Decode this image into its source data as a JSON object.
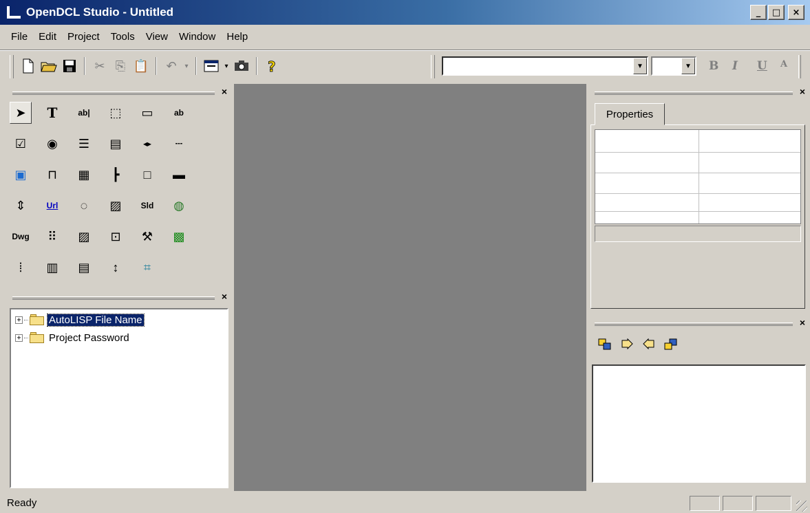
{
  "window": {
    "title": "OpenDCL Studio - Untitled",
    "minimize": "_",
    "maximize": "□",
    "close": "×"
  },
  "menu": {
    "items": [
      "File",
      "Edit",
      "Project",
      "Tools",
      "View",
      "Window",
      "Help"
    ]
  },
  "format_toolbar": {
    "bold": "B",
    "italic": "I",
    "underline": "U",
    "font_name": "",
    "font_size": ""
  },
  "palette": {
    "tools": [
      {
        "icon": "pointer-icon",
        "glyph": "➤"
      },
      {
        "icon": "text-icon",
        "glyph": "T"
      },
      {
        "icon": "textbox-icon",
        "glyph": "ab|"
      },
      {
        "icon": "picture-button-icon",
        "glyph": "⬚"
      },
      {
        "icon": "frame-icon",
        "glyph": "▭"
      },
      {
        "icon": "combo-text-icon",
        "glyph": "ab"
      },
      {
        "icon": "checkbox-icon",
        "glyph": "☑"
      },
      {
        "icon": "option-button-icon",
        "glyph": "◉"
      },
      {
        "icon": "listbox-icon",
        "glyph": "☰"
      },
      {
        "icon": "list-view-icon",
        "glyph": "▤"
      },
      {
        "icon": "spin-icon",
        "glyph": "◂▸"
      },
      {
        "icon": "slider-icon",
        "glyph": "┄"
      },
      {
        "icon": "picture-icon",
        "glyph": "▣"
      },
      {
        "icon": "tab-control-icon",
        "glyph": "⊓"
      },
      {
        "icon": "calendar-icon",
        "glyph": "▦"
      },
      {
        "icon": "tree-icon",
        "glyph": "┣"
      },
      {
        "icon": "blank-control-icon",
        "glyph": "□"
      },
      {
        "icon": "progress-icon",
        "glyph": "▬"
      },
      {
        "icon": "scroll-icon",
        "glyph": "⇕"
      },
      {
        "icon": "url-icon",
        "glyph": "Url"
      },
      {
        "icon": "animation-icon",
        "glyph": "◌"
      },
      {
        "icon": "image-button-icon",
        "glyph": "▨"
      },
      {
        "icon": "slide-icon",
        "glyph": "Sld"
      },
      {
        "icon": "globe-icon",
        "glyph": "◍"
      },
      {
        "icon": "dwg-icon",
        "glyph": "Dwg"
      },
      {
        "icon": "grid-icon",
        "glyph": "⠿"
      },
      {
        "icon": "image-combo-icon",
        "glyph": "▨"
      },
      {
        "icon": "graphic-button-icon",
        "glyph": "⊡"
      },
      {
        "icon": "tools-icon",
        "glyph": "⚒"
      },
      {
        "icon": "digital-display-icon",
        "glyph": "▩"
      },
      {
        "icon": "splitter-icon",
        "glyph": "⦙"
      },
      {
        "icon": "block-list-icon",
        "glyph": "▥"
      },
      {
        "icon": "table-icon",
        "glyph": "▤"
      },
      {
        "icon": "vertical-spacer-icon",
        "glyph": "↕"
      },
      {
        "icon": "html-control-icon",
        "glyph": "⌗"
      }
    ]
  },
  "tree": {
    "items": [
      {
        "label": "AutoLISP File Name",
        "selected": true
      },
      {
        "label": "Project Password",
        "selected": false
      }
    ]
  },
  "properties": {
    "tab_label": "Properties"
  },
  "events_toolbar": {
    "icons": [
      "move-up-icon",
      "move-right-icon",
      "move-left-icon",
      "move-down-icon"
    ]
  },
  "status": {
    "text": "Ready"
  },
  "colors": {
    "title_start": "#0a246a",
    "title_end": "#a6caf0",
    "workspace": "#808080",
    "face": "#d4d0c8"
  }
}
